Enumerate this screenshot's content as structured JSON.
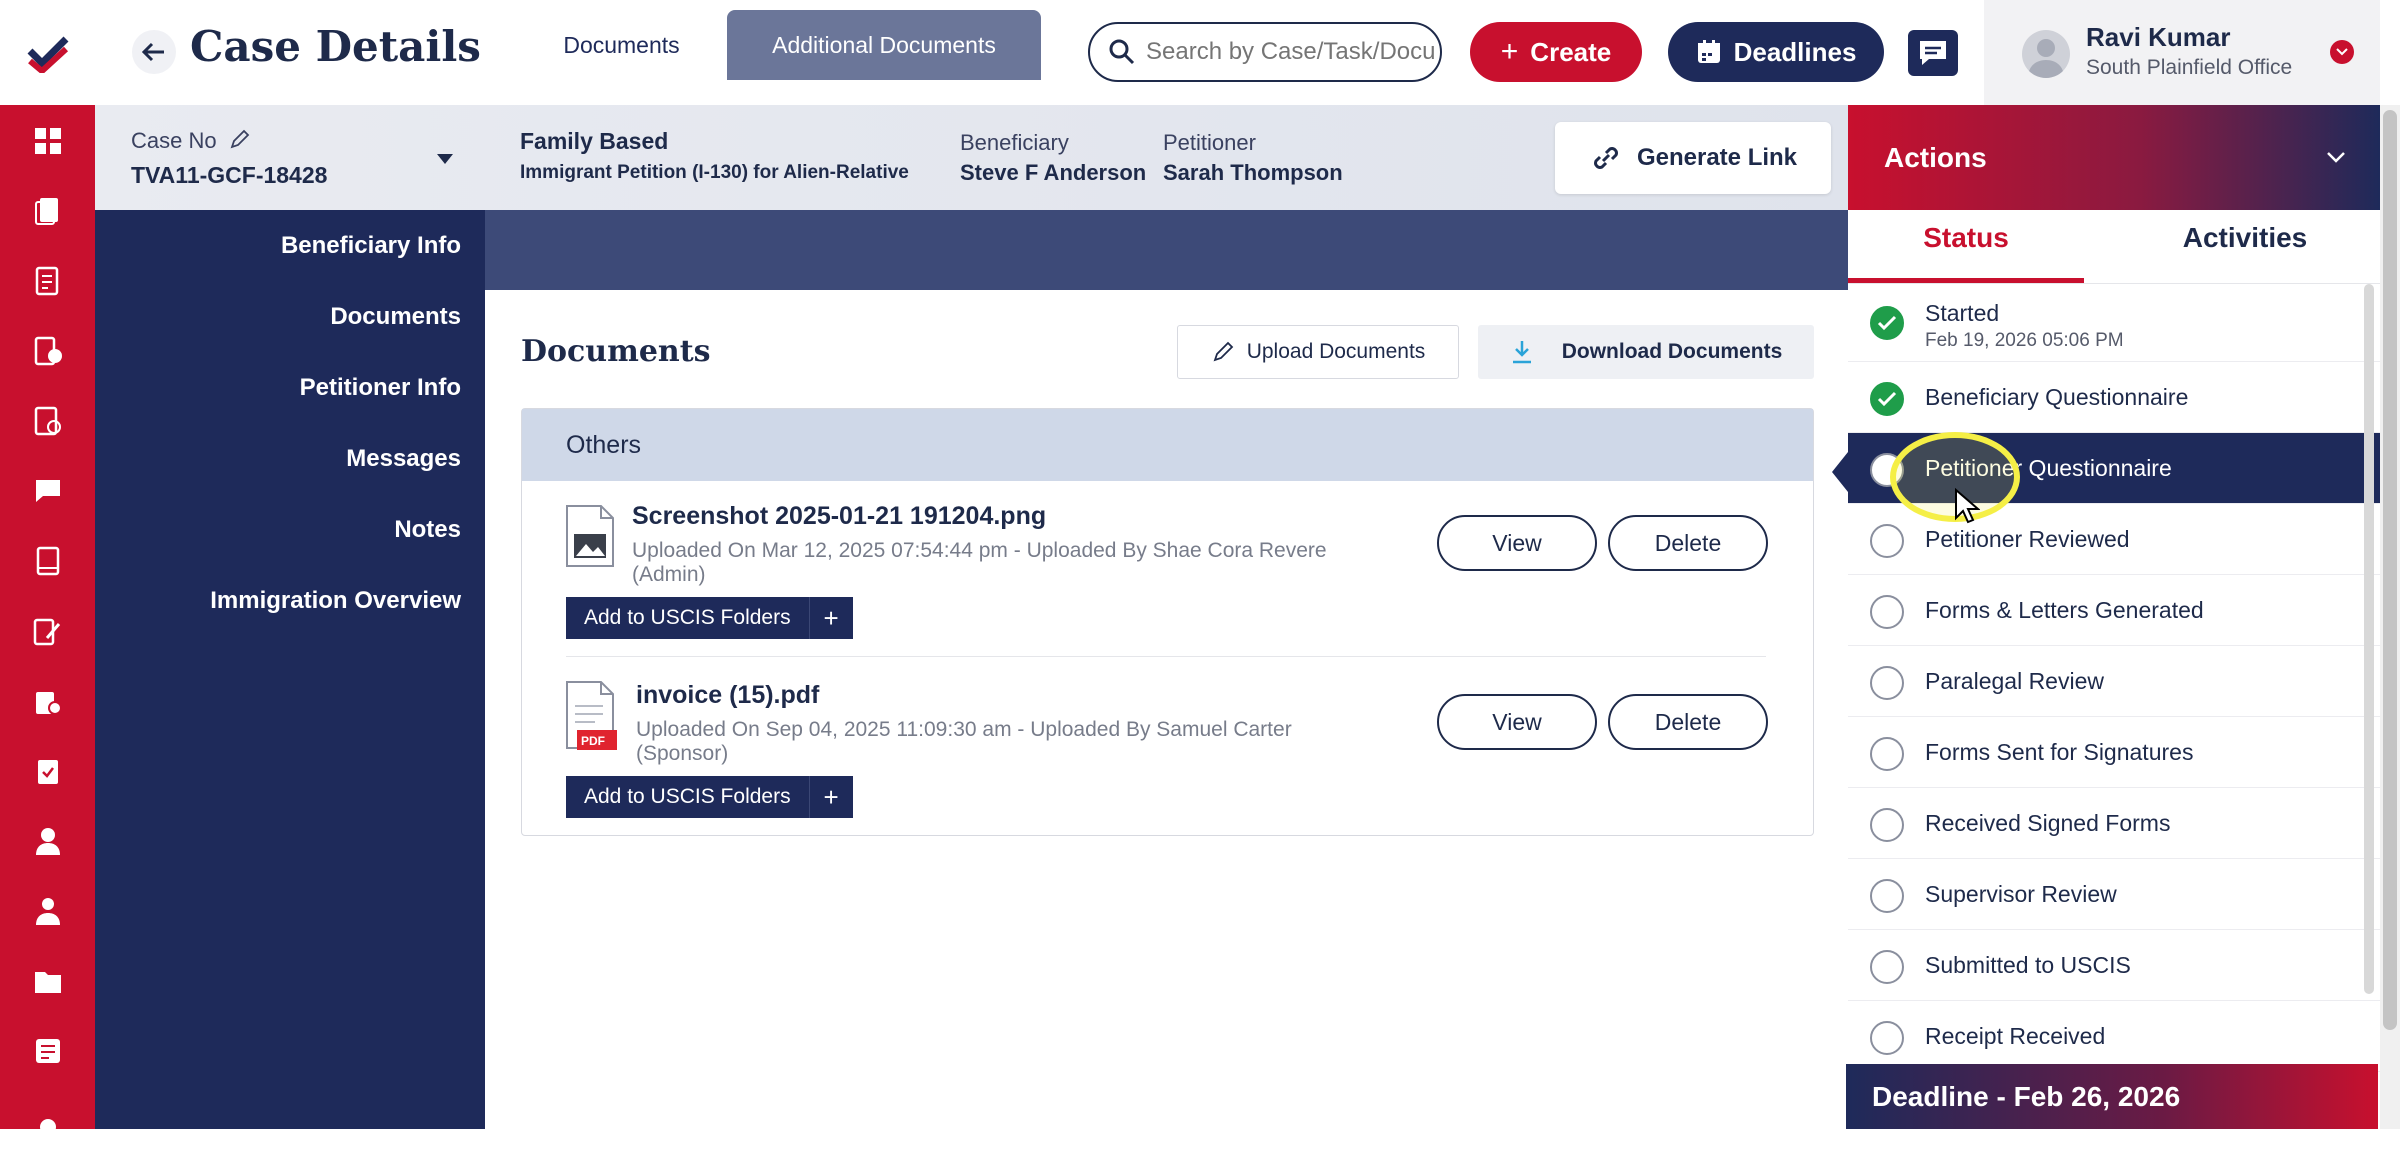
{
  "colors": {
    "brand_red": "#c8102e",
    "navy": "#1e2a5a",
    "success_green": "#1f9d4a"
  },
  "header": {
    "title": "Case Details",
    "search_placeholder": "Search by Case/Task/Docu",
    "create_label": "Create",
    "deadlines_label": "Deadlines",
    "user_name": "Ravi Kumar",
    "user_office": "South Plainfield Office"
  },
  "rail_icons": [
    "dashboard-icon",
    "documents-icon",
    "checklist-icon",
    "billing-icon",
    "forms-icon",
    "messages-icon",
    "book-icon",
    "edit-icon",
    "folder-check-icon",
    "clipboard-icon",
    "user-icon",
    "team-icon",
    "folder-icon",
    "notes-icon",
    "more-icon"
  ],
  "case": {
    "case_no_label": "Case No",
    "case_no": "TVA11-GCF-18428",
    "category": "Family Based",
    "petition": "Immigrant Petition (I-130) for Alien-Relative",
    "beneficiary_label": "Beneficiary",
    "beneficiary": "Steve F Anderson",
    "petitioner_label": "Petitioner",
    "petitioner": "Sarah Thompson",
    "generate_link_label": "Generate Link"
  },
  "left_nav": {
    "items": [
      "Beneficiary Info",
      "Documents",
      "Petitioner Info",
      "Messages",
      "Notes",
      "Immigration Overview"
    ],
    "active": "Documents"
  },
  "tabs": {
    "documents": "Documents",
    "additional": "Additional Documents"
  },
  "documents": {
    "title": "Documents",
    "upload_label": "Upload Documents",
    "download_label": "Download Documents",
    "group": "Others",
    "add_uscis_label": "Add to USCIS Folders",
    "add_uscis_plus": "+",
    "view_label": "View",
    "delete_label": "Delete",
    "files": [
      {
        "name": "Screenshot 2025-01-21 191204.png",
        "meta1": "Uploaded On Mar 12, 2025 07:54:44 pm - Uploaded By Shae Cora Revere",
        "meta2": "(Admin)",
        "type": "image"
      },
      {
        "name": "invoice (15).pdf",
        "meta1": "Uploaded On Sep 04, 2025 11:09:30 am - Uploaded By Samuel Carter",
        "meta2": "(Sponsor)",
        "type": "pdf"
      }
    ]
  },
  "actions": {
    "title": "Actions",
    "tab_status": "Status",
    "tab_activities": "Activities",
    "statuses": [
      {
        "label": "Started",
        "sub": "Feb 19, 2026 05:06 PM",
        "done": true
      },
      {
        "label": "Beneficiary Questionnaire",
        "done": true
      },
      {
        "label": "Petitioner Questionnaire",
        "done": false,
        "active": true
      },
      {
        "label": "Petitioner Reviewed",
        "done": false
      },
      {
        "label": "Forms & Letters Generated",
        "done": false
      },
      {
        "label": "Paralegal Review",
        "done": false
      },
      {
        "label": "Forms Sent for Signatures",
        "done": false
      },
      {
        "label": "Received Signed Forms",
        "done": false
      },
      {
        "label": "Supervisor Review",
        "done": false
      },
      {
        "label": "Submitted to USCIS",
        "done": false
      },
      {
        "label": "Receipt Received",
        "done": false
      }
    ],
    "deadline": "Deadline - Feb 26, 2026"
  },
  "pdf_badge": "PDF"
}
